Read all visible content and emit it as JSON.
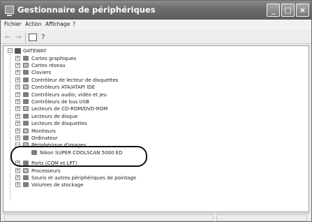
{
  "window": {
    "title": "Gestionnaire de périphériques",
    "minimize_glyph": "_",
    "maximize_glyph": "□",
    "close_glyph": "×"
  },
  "menu": {
    "file": "Fichier",
    "action": "Action",
    "view": "Affichage",
    "help": "?"
  },
  "toolbar": {
    "back_glyph": "←",
    "forward_glyph": "→",
    "properties_glyph": "☰",
    "help_glyph": "?"
  },
  "tree": {
    "root": "GATEWAY",
    "collapsed_glyph": "+",
    "expanded_glyph": "−",
    "items": [
      {
        "label": "Cartes graphiques",
        "icon": "display-adapter-icon"
      },
      {
        "label": "Cartes réseau",
        "icon": "network-adapter-icon"
      },
      {
        "label": "Claviers",
        "icon": "keyboard-icon"
      },
      {
        "label": "Contrôleur de lecteur de disquettes",
        "icon": "floppy-controller-icon"
      },
      {
        "label": "Contrôleurs ATA/ATAPI IDE",
        "icon": "ide-controller-icon"
      },
      {
        "label": "Contrôleurs audio, vidéo et jeu",
        "icon": "sound-icon"
      },
      {
        "label": "Contrôleurs de bus USB",
        "icon": "usb-icon"
      },
      {
        "label": "Lecteurs de CD-ROM/DVD-ROM",
        "icon": "cdrom-icon"
      },
      {
        "label": "Lecteurs de disque",
        "icon": "disk-drive-icon"
      },
      {
        "label": "Lecteurs de disquettes",
        "icon": "floppy-drive-icon"
      },
      {
        "label": "Moniteurs",
        "icon": "monitor-icon"
      },
      {
        "label": "Ordinateur",
        "icon": "computer-icon"
      }
    ],
    "imaging": {
      "label": "Périphérique d'images",
      "icon": "imaging-device-icon"
    },
    "scanner": {
      "label": "Nikon SUPER COOLSCAN 5000 ED",
      "icon": "scanner-icon"
    },
    "items_after": [
      {
        "label": "Ports (COM et LPT)",
        "icon": "port-icon"
      },
      {
        "label": "Processeurs",
        "icon": "processor-icon"
      },
      {
        "label": "Souris et autres périphériques de pointage",
        "icon": "mouse-icon"
      },
      {
        "label": "Volumes de stockage",
        "icon": "storage-volume-icon"
      }
    ]
  }
}
